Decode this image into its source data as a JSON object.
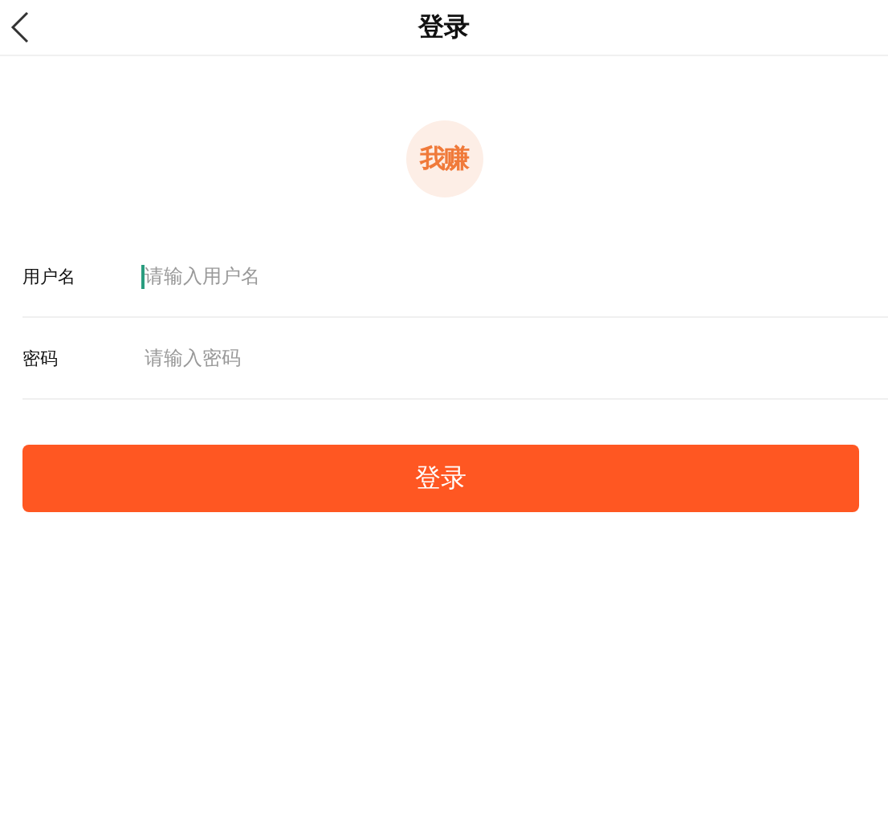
{
  "header": {
    "title": "登录"
  },
  "logo": {
    "text": "我赚"
  },
  "fields": [
    {
      "label": "用户名",
      "placeholder": "请输入用户名",
      "focused": true
    },
    {
      "label": "密码",
      "placeholder": "请输入密码",
      "focused": false
    }
  ],
  "submit": {
    "label": "登录"
  }
}
